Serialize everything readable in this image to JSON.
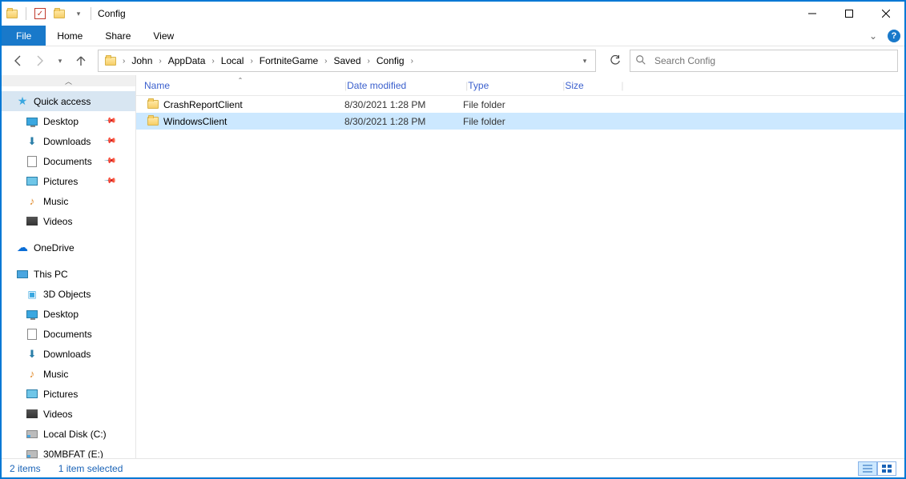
{
  "window": {
    "title": "Config"
  },
  "ribbon": {
    "file": "File",
    "tabs": [
      "Home",
      "Share",
      "View"
    ]
  },
  "breadcrumbs": [
    "John",
    "AppData",
    "Local",
    "FortniteGame",
    "Saved",
    "Config"
  ],
  "search": {
    "placeholder": "Search Config"
  },
  "sidebar": {
    "quickAccess": {
      "label": "Quick access"
    },
    "quickItems": [
      {
        "label": "Desktop",
        "icon": "monitor",
        "pinned": true
      },
      {
        "label": "Downloads",
        "icon": "down",
        "pinned": true
      },
      {
        "label": "Documents",
        "icon": "doc",
        "pinned": true
      },
      {
        "label": "Pictures",
        "icon": "pic",
        "pinned": true
      },
      {
        "label": "Music",
        "icon": "music",
        "pinned": false
      },
      {
        "label": "Videos",
        "icon": "video",
        "pinned": false
      }
    ],
    "oneDrive": {
      "label": "OneDrive"
    },
    "thisPC": {
      "label": "This PC"
    },
    "pcItems": [
      {
        "label": "3D Objects",
        "icon": "cube"
      },
      {
        "label": "Desktop",
        "icon": "monitor"
      },
      {
        "label": "Documents",
        "icon": "doc"
      },
      {
        "label": "Downloads",
        "icon": "down"
      },
      {
        "label": "Music",
        "icon": "music"
      },
      {
        "label": "Pictures",
        "icon": "pic"
      },
      {
        "label": "Videos",
        "icon": "video"
      },
      {
        "label": "Local Disk (C:)",
        "icon": "disk"
      },
      {
        "label": "30MBFAT (E:)",
        "icon": "disk"
      }
    ]
  },
  "columns": {
    "name": "Name",
    "date": "Date modified",
    "type": "Type",
    "size": "Size"
  },
  "rows": [
    {
      "name": "CrashReportClient",
      "date": "8/30/2021 1:28 PM",
      "type": "File folder",
      "size": "",
      "selected": false
    },
    {
      "name": "WindowsClient",
      "date": "8/30/2021 1:28 PM",
      "type": "File folder",
      "size": "",
      "selected": true
    }
  ],
  "status": {
    "count": "2 items",
    "selected": "1 item selected"
  }
}
